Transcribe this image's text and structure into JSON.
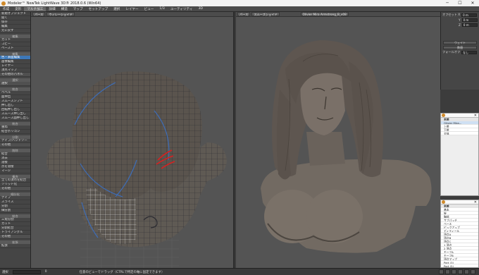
{
  "window": {
    "title": "Modeler™ NewTek LightWave 3D® 2018.0.6 (Win64)",
    "controls": [
      "─",
      "☐",
      "✕"
    ]
  },
  "menubar": [
    "作成",
    "変形",
    "マルチ加工",
    "詳細",
    "構造",
    "マップ",
    "セットアップ",
    "選択",
    "レイヤー",
    "ビュー",
    "1/3",
    "ユーティリティ",
    "3D"
  ],
  "menubar_selected": 2,
  "sidebar": [
    {
      "type": "btn",
      "label": "新規オブジェクト"
    },
    {
      "type": "btn",
      "label": "開く"
    },
    {
      "type": "btn",
      "label": "保存"
    },
    {
      "type": "btn",
      "label": "編集"
    },
    {
      "type": "btn",
      "label": "元に戻す"
    },
    {
      "type": "sec",
      "label": "編集"
    },
    {
      "type": "btn",
      "label": "カット"
    },
    {
      "type": "btn",
      "label": "コピー"
    },
    {
      "type": "btn",
      "label": "ペースト"
    },
    {
      "type": "sec",
      "label": "編集"
    },
    {
      "type": "btn",
      "label": "色・表面編集",
      "hl": true
    },
    {
      "type": "btn",
      "label": "画像編集"
    },
    {
      "type": "btn",
      "label": "レイヤー"
    },
    {
      "type": "btn",
      "label": "頂点マップ"
    },
    {
      "type": "btn",
      "label": "その他のパネル",
      "dd": true
    },
    {
      "type": "sec",
      "label": "選択"
    },
    {
      "type": "btn",
      "label": "選択",
      "dd": true
    },
    {
      "type": "sec",
      "label": "統合"
    },
    {
      "type": "btn",
      "label": "ベベル"
    },
    {
      "type": "btn",
      "label": "面押出"
    },
    {
      "type": "btn",
      "label": "スムーズシフト"
    },
    {
      "type": "btn",
      "label": "押し出し"
    },
    {
      "type": "btn",
      "label": "回転押し出し"
    },
    {
      "type": "btn",
      "label": "スムーズ押し出し"
    },
    {
      "type": "btn",
      "label": "スムーズ面押し出し"
    },
    {
      "type": "sec",
      "label": "統合"
    },
    {
      "type": "btn",
      "label": "重ね"
    },
    {
      "type": "btn",
      "label": "結合ポリゴン"
    },
    {
      "type": "sec",
      "label": "分割"
    },
    {
      "type": "btn",
      "label": "ナイフ/バンドソー"
    },
    {
      "type": "btn",
      "label": "その他",
      "dd": true
    },
    {
      "type": "sec",
      "label": "削除"
    },
    {
      "type": "btn",
      "label": "結合"
    },
    {
      "type": "btn",
      "label": "消去"
    },
    {
      "type": "btn",
      "label": "溶接"
    },
    {
      "type": "btn",
      "label": "点を溶接"
    },
    {
      "type": "btn",
      "label": "マージ"
    },
    {
      "type": "sec",
      "label": "複合"
    },
    {
      "type": "btn",
      "label": "全ての頂点を結合"
    },
    {
      "type": "btn",
      "label": "ソリッド化"
    },
    {
      "type": "btn",
      "label": "その他",
      "dd": true
    },
    {
      "type": "sec",
      "label": "細分化"
    },
    {
      "type": "btn",
      "label": "ナイフ"
    },
    {
      "type": "btn",
      "label": "スライス"
    },
    {
      "type": "btn",
      "label": "分割"
    },
    {
      "type": "btn",
      "label": "細分割"
    },
    {
      "type": "sec",
      "label": "結合"
    },
    {
      "type": "btn",
      "label": "三角分割"
    },
    {
      "type": "btn",
      "label": "カット"
    },
    {
      "type": "btn",
      "label": "分割結合"
    },
    {
      "type": "btn",
      "label": "トライアングル"
    },
    {
      "type": "btn",
      "label": "その他",
      "dd": true
    },
    {
      "type": "sec",
      "label": "拡張"
    },
    {
      "type": "btn",
      "label": "拡張"
    }
  ],
  "viewport_left": {
    "view": "パース",
    "shading": "ウィレーシェイド"
  },
  "viewport_right": {
    "view": "パース",
    "shading": "スムーズシェイド",
    "object": "Olivier Mira Armstrong_B_v08"
  },
  "right_panel": {
    "offset_label": "オフセット X",
    "fields": [
      {
        "label": "オフセット X",
        "value": "0 m"
      },
      {
        "label": "Y",
        "value": "0 m"
      },
      {
        "label": "Z",
        "value": "0 m"
      }
    ],
    "button1": "ウェイト",
    "button2": "数値",
    "falloff_label": "フォールオフ",
    "falloff_value": "なし"
  },
  "panel_a": {
    "rows": [
      {
        "label": "名前",
        "hdr": true
      },
      {
        "label": "Olivier Mira...",
        "sel": true
      },
      {
        "label": "  上層"
      },
      {
        "label": "  下層"
      },
      {
        "label": "  全体"
      }
    ]
  },
  "panel_b": {
    "rows": [
      {
        "label": "名前",
        "hdr": true
      },
      {
        "label": "基本"
      },
      {
        "label": "髪"
      },
      {
        "label": "胸部"
      },
      {
        "label": "サブパッチ"
      },
      {
        "label": "ベース"
      },
      {
        "label": "ピックアップ"
      },
      {
        "label": "ディティール"
      },
      {
        "label": "頂点A"
      },
      {
        "label": "頂点B"
      },
      {
        "label": "頂点C"
      },
      {
        "label": "1 頂点"
      },
      {
        "label": "2 頂点"
      },
      {
        "label": "モーフA"
      },
      {
        "label": "モーフB"
      },
      {
        "label": "頂点マップ"
      },
      {
        "label": "Part (3)"
      },
      {
        "label": "Part (5)"
      }
    ]
  },
  "statusbar": {
    "left_label": "選択",
    "num": "0",
    "message": "任意のビューでドラッグ（CTRLで特定の軸に固定できます）"
  }
}
